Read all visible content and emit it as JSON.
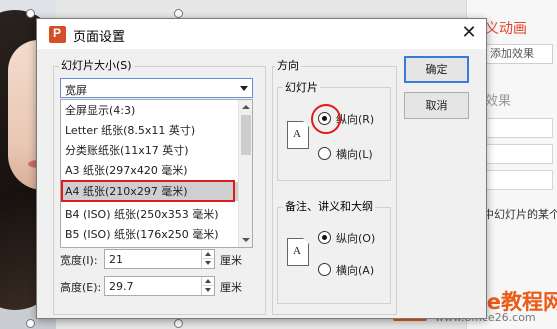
{
  "background": {
    "right_panel": {
      "title": "义动画",
      "select_value": "添加效果",
      "section_label": "效果",
      "description": "中幻灯片的某个"
    },
    "logo": {
      "title": "Office教程网",
      "subtitle": "www.office26.com"
    }
  },
  "dialog": {
    "title": "页面设置",
    "slide_size": {
      "group_label": "幻灯片大小(S)",
      "selected": "宽屏",
      "options": [
        "全屏显示(4:3)",
        "Letter 纸张(8.5x11 英寸)",
        "分类账纸张(11x17 英寸)",
        "A3 纸张(297x420 毫米)",
        "A4 纸张(210x297 毫米)",
        "B4 (ISO) 纸张(250x353 毫米)",
        "B5 (ISO) 纸张(176x250 毫米)"
      ],
      "highlighted_index": 4
    },
    "width": {
      "label": "宽度(I):",
      "value": "21",
      "unit": "厘米"
    },
    "height": {
      "label": "高度(E):",
      "value": "29.7",
      "unit": "厘米"
    },
    "orientation": {
      "group_label": "方向",
      "slides": {
        "label": "幻灯片",
        "icon_letter": "A",
        "portrait": "纵向(R)",
        "landscape": "横向(L)",
        "selected": "portrait"
      },
      "notes": {
        "label": "备注、讲义和大纲",
        "icon_letter": "A",
        "portrait": "纵向(O)",
        "landscape": "横向(A)",
        "selected": "portrait"
      }
    },
    "buttons": {
      "ok": "确定",
      "cancel": "取消"
    }
  }
}
